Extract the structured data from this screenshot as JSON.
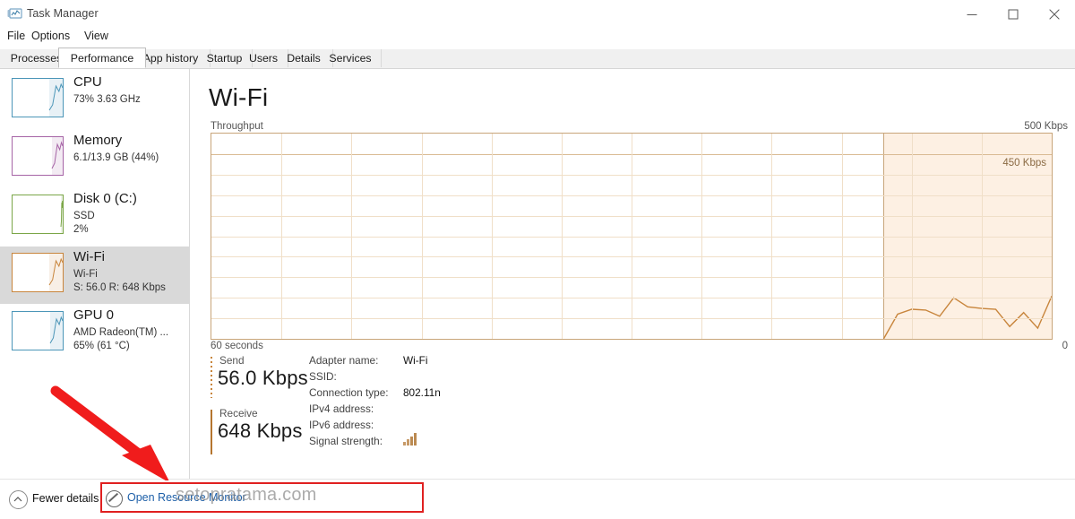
{
  "window": {
    "title": "Task Manager",
    "icon": "task-manager-icon",
    "controls": {
      "minimize": "Minimize",
      "maximize": "Maximize",
      "close": "Close"
    }
  },
  "menu": {
    "items": [
      "File",
      "Options",
      "View"
    ]
  },
  "tabs": {
    "items": [
      "Processes",
      "Performance",
      "App history",
      "Startup",
      "Users",
      "Details",
      "Services"
    ],
    "active": "Performance"
  },
  "sidebar": {
    "items": [
      {
        "name": "CPU",
        "line1": "73% 3.63 GHz",
        "line2": "",
        "color": "#4c96b8",
        "selected": false,
        "fill": 0.27
      },
      {
        "name": "Memory",
        "line1": "6.1/13.9 GB (44%)",
        "line2": "",
        "color": "#a664a6",
        "selected": false,
        "fill": 0.22
      },
      {
        "name": "Disk 0 (C:)",
        "line1": "SSD",
        "line2": "2%",
        "color": "#7ba648",
        "selected": false,
        "fill": 0.03
      },
      {
        "name": "Wi-Fi",
        "line1": "Wi-Fi",
        "line2": "S: 56.0 R: 648 Kbps",
        "color": "#c8853c",
        "selected": true,
        "fill": 0.26
      },
      {
        "name": "GPU 0",
        "line1": "AMD Radeon(TM) ...",
        "line2": "65% (61 °C)",
        "color": "#4c96b8",
        "selected": false,
        "fill": 0.25
      }
    ]
  },
  "main": {
    "title": "Wi-Fi",
    "graph_label": "Throughput",
    "scale_max": "500 Kbps",
    "current_peak_label": "450 Kbps",
    "time_label": "60 seconds",
    "zero_label": "0"
  },
  "stats": {
    "send": {
      "label": "Send",
      "value": "56.0 Kbps"
    },
    "receive": {
      "label": "Receive",
      "value": "648 Kbps"
    },
    "details": [
      {
        "key": "Adapter name:",
        "value": "Wi-Fi"
      },
      {
        "key": "SSID:",
        "value": ""
      },
      {
        "key": "Connection type:",
        "value": "802.11n"
      },
      {
        "key": "IPv4 address:",
        "value": ""
      },
      {
        "key": "IPv6 address:",
        "value": ""
      },
      {
        "key": "Signal strength:",
        "value": ""
      }
    ]
  },
  "footer": {
    "fewer_details": "Fewer details",
    "open_resource_monitor": "Open Resource Monitor"
  },
  "annotations": {
    "watermark": "setopratama.com",
    "highlight_color": "#e02020"
  },
  "chart_data": {
    "type": "line",
    "title": "Throughput",
    "xlabel": "60 seconds",
    "ylabel": "Kbps",
    "ylim": [
      0,
      500
    ],
    "xlim": [
      0,
      60
    ],
    "grid": true,
    "active_window_start_s": 48,
    "peak_annotation": "450 Kbps",
    "series": [
      {
        "name": "Throughput",
        "color": "#c8853c",
        "x": [
          48,
          49,
          50,
          51,
          52,
          53,
          54,
          55,
          56,
          57,
          58,
          59,
          60
        ],
        "values": [
          0,
          60,
          72,
          70,
          55,
          100,
          78,
          74,
          72,
          30,
          64,
          26,
          104
        ]
      }
    ]
  }
}
